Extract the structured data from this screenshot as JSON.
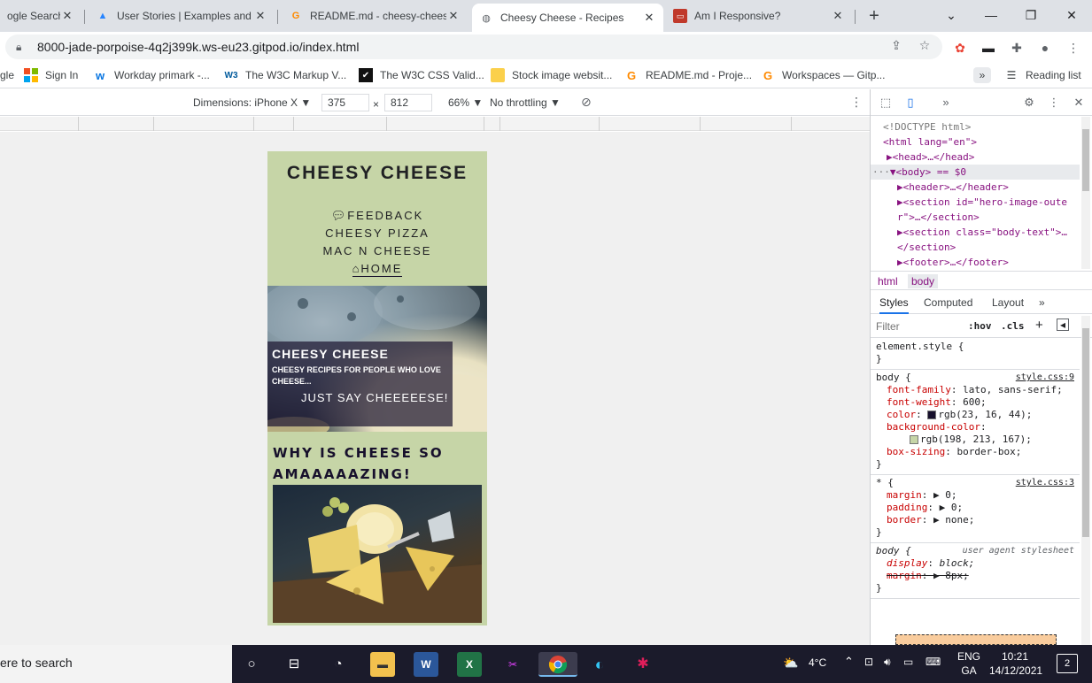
{
  "tabs": [
    {
      "title": "ogle Search",
      "icon": "google-icon",
      "active": false
    },
    {
      "title": "User Stories | Examples and T",
      "icon": "atlassian-icon",
      "active": false
    },
    {
      "title": "README.md - cheesy-chees",
      "icon": "gitpod-icon",
      "active": false
    },
    {
      "title": "Cheesy Cheese - Recipes",
      "icon": "globe-icon",
      "active": true
    },
    {
      "title": "Am I Responsive?",
      "icon": "amiresponsive-icon",
      "active": false
    }
  ],
  "window_controls": {
    "dropdown": "⌄",
    "minimize": "—",
    "restore": "❐",
    "close": "✕"
  },
  "address": {
    "url": "8000-jade-porpoise-4q2j399k.ws-eu23.gitpod.io/index.html"
  },
  "bookmarks": [
    {
      "label": "gle",
      "icon": "google-icon"
    },
    {
      "label": "Sign In",
      "icon": "microsoft-icon"
    },
    {
      "label": "Workday primark -...",
      "icon": "workday-icon"
    },
    {
      "label": "The W3C Markup V...",
      "icon": "w3c-icon"
    },
    {
      "label": "The W3C CSS Valid...",
      "icon": "w3c-css-icon"
    },
    {
      "label": "Stock image websit...",
      "icon": "folder-icon"
    },
    {
      "label": "README.md - Proje...",
      "icon": "gitpod-icon"
    },
    {
      "label": "Workspaces — Gitp...",
      "icon": "gitpod-icon"
    }
  ],
  "reading_list": "Reading list",
  "device_toolbar": {
    "dimensions_label": "Dimensions: iPhone X",
    "width": "375",
    "times": "×",
    "height": "812",
    "zoom": "66%",
    "throttling": "No throttling"
  },
  "page": {
    "site_title": "CHEESY CHEESE",
    "nav": [
      "FEEDBACK",
      "CHEESY PIZZA",
      "MAC N CHEESE",
      "HOME"
    ],
    "hero_heading": "CHEESY CHEESE",
    "hero_sub": "CHEESY RECIPES FOR PEOPLE WHO LOVE CHEESE...",
    "hero_tagline": "JUST SAY CHEEEEESE!",
    "section_heading_1": "WHY IS CHEESE SO",
    "section_heading_2": "AMAAAAAZING!"
  },
  "devtools": {
    "elements": [
      {
        "text": "<!DOCTYPE html>",
        "indent": 0
      },
      {
        "text": "<html lang=\"en\">",
        "indent": 0
      },
      {
        "text": "▶<head>…</head>",
        "indent": 1
      },
      {
        "text": "▼<body> == $0",
        "indent": 0
      },
      {
        "text": "▶<header>…</header>",
        "indent": 2
      },
      {
        "text": "▶<section id=\"hero-image-oute",
        "indent": 2
      },
      {
        "text": "r\">…</section>",
        "indent": 2
      },
      {
        "text": "▶<section class=\"body-text\">…",
        "indent": 2
      },
      {
        "text": "</section>",
        "indent": 2
      },
      {
        "text": "▶<footer>…</footer>",
        "indent": 2
      }
    ],
    "crumbs": [
      "html",
      "body"
    ],
    "subtabs": [
      "Styles",
      "Computed",
      "Layout",
      "»"
    ],
    "filter_placeholder": "Filter",
    "hov": ":hov",
    "cls": ".cls",
    "rules": [
      {
        "selector": "element.style {",
        "source": "",
        "props": []
      },
      {
        "selector": "body {",
        "source": "style.css:9",
        "props": [
          {
            "name": "font-family",
            "value": "lato, sans-serif;"
          },
          {
            "name": "font-weight",
            "value": "600;"
          },
          {
            "name": "color",
            "value": "rgb(23, 16, 44);",
            "swatch": "#17102c"
          },
          {
            "name": "background-color",
            "value": "",
            "swatch": null
          },
          {
            "name": "",
            "value": "rgb(198, 213, 167);",
            "swatch": "#c6d5a7"
          },
          {
            "name": "box-sizing",
            "value": "border-box;"
          }
        ]
      },
      {
        "selector": "* {",
        "source": "style.css:3",
        "props": [
          {
            "name": "margin",
            "value": "▶ 0;"
          },
          {
            "name": "padding",
            "value": "▶ 0;"
          },
          {
            "name": "border",
            "value": "▶ none;"
          }
        ]
      },
      {
        "selector": "body {",
        "source": "user agent stylesheet",
        "props": [
          {
            "name": "display",
            "value": "block;",
            "strike": true
          },
          {
            "name": "margin",
            "value": "▶ 8px;",
            "strike": true
          }
        ]
      }
    ]
  },
  "taskbar": {
    "search_text": "ere to search",
    "weather": "4°C",
    "lang1": "ENG",
    "lang2": "GA",
    "time": "10:21",
    "date": "14/12/2021",
    "notifications": "2"
  }
}
